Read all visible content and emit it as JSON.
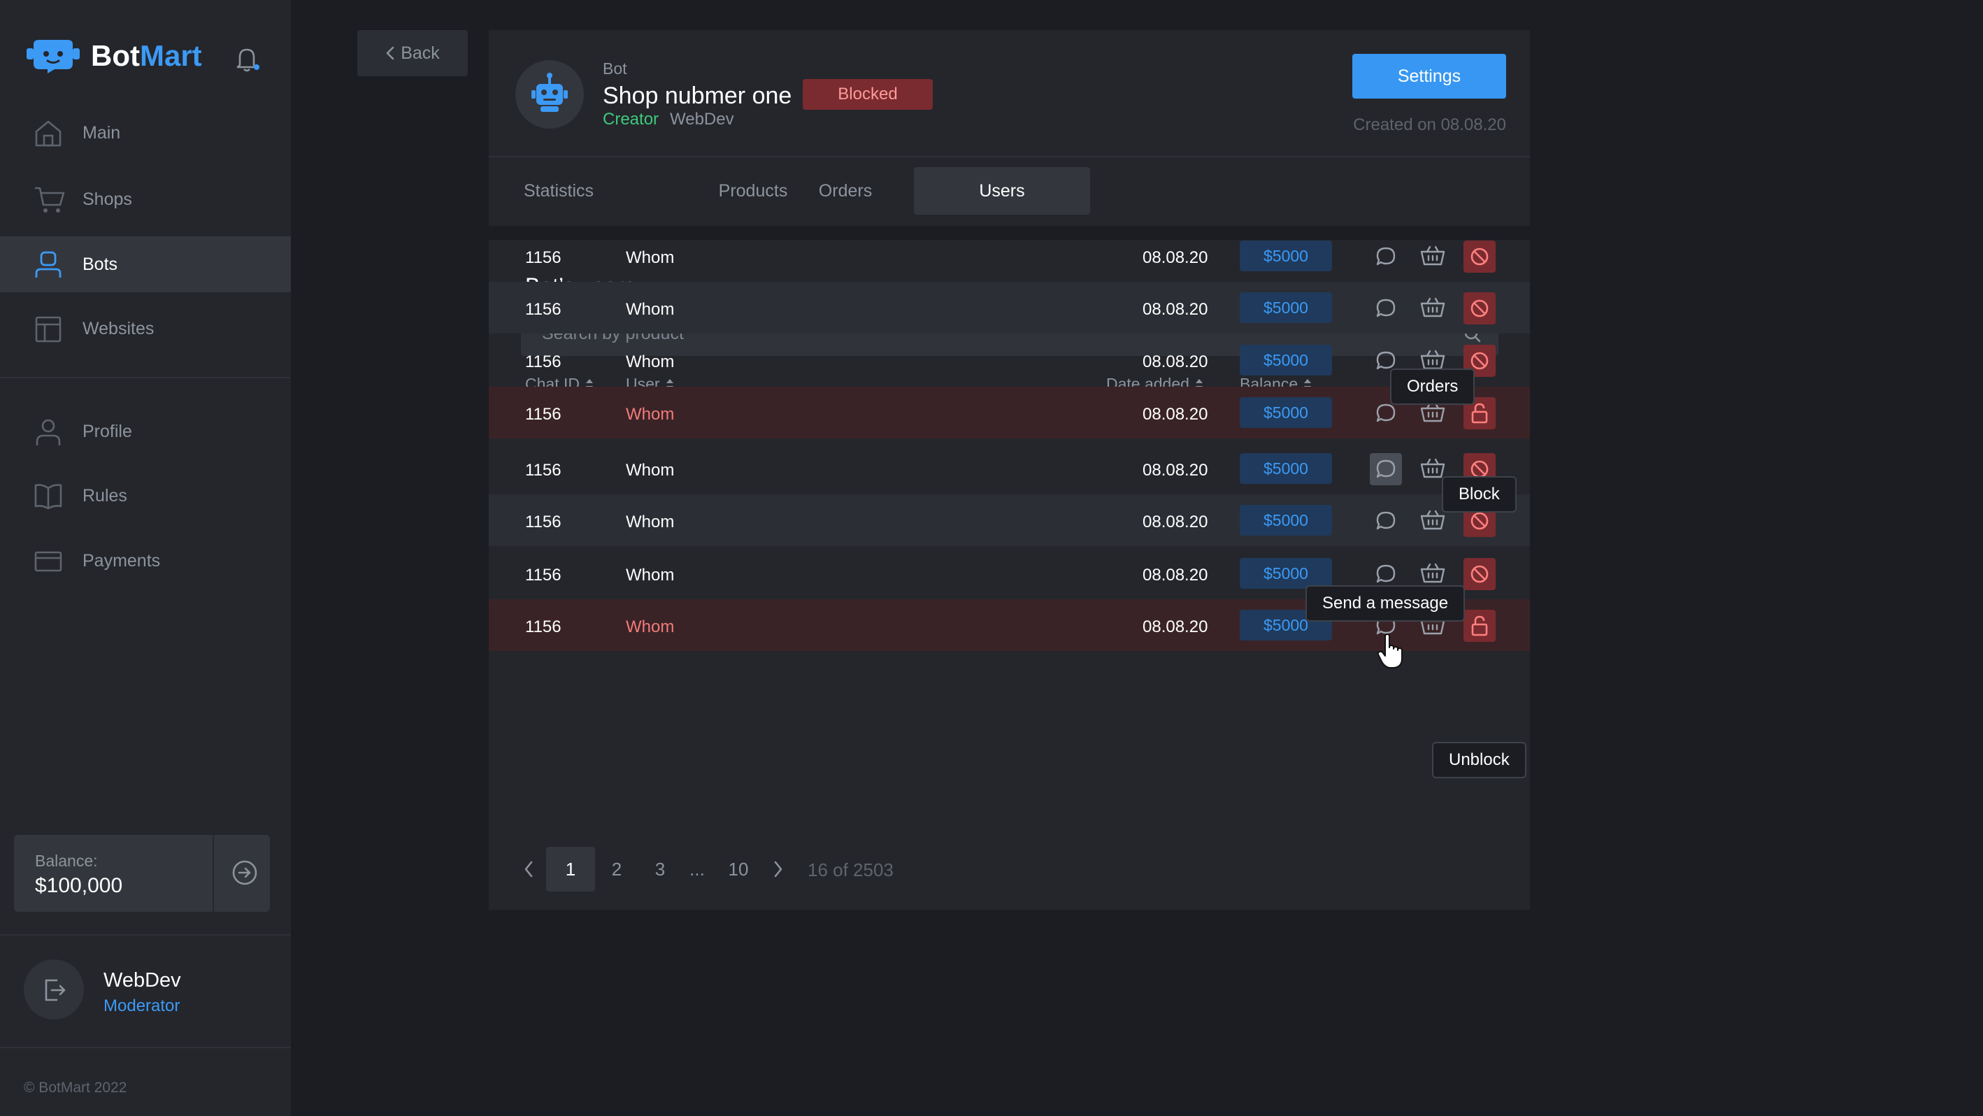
{
  "brand": {
    "bot": "Bot",
    "mart": "Mart"
  },
  "sidebar": {
    "nav": [
      {
        "label": "Main",
        "icon": "home-icon"
      },
      {
        "label": "Shops",
        "icon": "cart-icon"
      },
      {
        "label": "Bots",
        "icon": "user-bot-icon",
        "active": true
      },
      {
        "label": "Websites",
        "icon": "layout-icon"
      }
    ],
    "nav2": [
      {
        "label": "Profile",
        "icon": "profile-icon"
      },
      {
        "label": "Rules",
        "icon": "book-icon"
      },
      {
        "label": "Payments",
        "icon": "card-icon"
      }
    ],
    "balance_caption": "Balance:",
    "balance_value": "$100,000",
    "user": {
      "name": "WebDev",
      "role": "Moderator"
    },
    "copyright": "© BotMart 2022"
  },
  "back_label": "Back",
  "bot": {
    "caption": "Bot",
    "name": "Shop nubmer one",
    "status": "Blocked",
    "creator_label": "Creator",
    "creator": "WebDev",
    "settings_label": "Settings",
    "created": "Created on  08.08.20"
  },
  "tabs": [
    "Statistics",
    "Products",
    "Orders",
    "Users"
  ],
  "active_tab": "Users",
  "users": {
    "title": "Bot’s users",
    "search_placeholder": "Search by product",
    "columns": {
      "chat_id": "Chat ID",
      "user": "User",
      "date": "Date added",
      "balance": "Balance"
    },
    "rows": [
      {
        "chat_id": "1156",
        "user": "Whom",
        "date": "08.08.20",
        "balance": "$5000",
        "blocked": false
      },
      {
        "chat_id": "1156",
        "user": "Whom",
        "date": "08.08.20",
        "balance": "$5000",
        "blocked": false
      },
      {
        "chat_id": "1156",
        "user": "Whom",
        "date": "08.08.20",
        "balance": "$5000",
        "blocked": false
      },
      {
        "chat_id": "1156",
        "user": "Whom",
        "date": "08.08.20",
        "balance": "$5000",
        "blocked": true
      },
      {
        "chat_id": "1156",
        "user": "Whom",
        "date": "08.08.20",
        "balance": "$5000",
        "blocked": false
      },
      {
        "chat_id": "1156",
        "user": "Whom",
        "date": "08.08.20",
        "balance": "$5000",
        "blocked": false
      },
      {
        "chat_id": "1156",
        "user": "Whom",
        "date": "08.08.20",
        "balance": "$5000",
        "blocked": false
      },
      {
        "chat_id": "1156",
        "user": "Whom",
        "date": "08.08.20",
        "balance": "$5000",
        "blocked": true
      }
    ],
    "tooltips": {
      "orders": "Orders",
      "block": "Block",
      "message": "Send a message",
      "unblock": "Unblock"
    }
  },
  "pagination": {
    "pages": [
      "1",
      "2",
      "3",
      "...",
      "10"
    ],
    "current": "1",
    "info": "16 of 2503"
  }
}
